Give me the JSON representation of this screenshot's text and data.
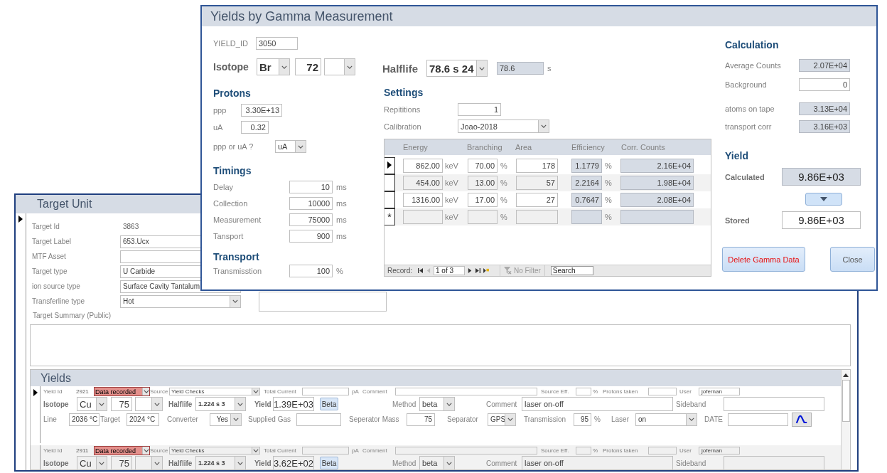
{
  "target_unit": {
    "title": "Target Unit",
    "fields": [
      {
        "label": "Target Id",
        "value": "3863",
        "kind": "text"
      },
      {
        "label": "Target Label",
        "value": "653.Ucx",
        "kind": "field"
      },
      {
        "label": "MTF Asset",
        "kind": "field"
      },
      {
        "label": "Target type",
        "value": "U Carbide",
        "kind": "field"
      },
      {
        "label": "ion source type",
        "value": "Surface Cavity Tantalum",
        "kind": "field"
      },
      {
        "label": "Transferline type",
        "value": "Hot",
        "kind": "dropdown"
      }
    ],
    "summary_label": "Target Summary (Public)",
    "yields": {
      "title": "Yields",
      "records": [
        {
          "selected": true,
          "yield_id_label": "Yield Id",
          "yield_id": "2921",
          "status": "Data recorded",
          "source_label": "Source",
          "source": "Yield Checks",
          "total_current_label": "Total Current",
          "current_unit": "pA",
          "comment_label": "Comment",
          "source_eff_label": "Source Eff.",
          "percent": "%",
          "protons_label": "Protons taken",
          "user_label": "User",
          "user": "jofernan",
          "isotope_label": "Isotope",
          "element": "Cu",
          "mass": "75",
          "halflife_label": "Halflife",
          "halflife": "1.224 s 3",
          "yield_label": "Yield",
          "yield": "1.39E+03",
          "beta_button": "Beta",
          "method_label": "Method",
          "method": "beta",
          "note_label": "Comment",
          "note": "laser on-off",
          "sideband_label": "Sideband",
          "line_label": "Line",
          "line": "2036 °C",
          "target_label": "Target",
          "target": "2024 °C",
          "converter_label": "Converter",
          "converter": "Yes",
          "gas_label": "Supplied Gas",
          "sep_mass_label": "Seperator Mass",
          "sep_mass": "75",
          "separator_label": "Separator",
          "separator": "GPS",
          "transmission_label": "Transmission",
          "transmission": "95",
          "transmission_unit": "%",
          "laser_label": "Laser",
          "laser": "on",
          "date_label": "DATE"
        },
        {
          "selected": false,
          "yield_id_label": "Yield Id",
          "yield_id": "2911",
          "status": "Data recorded",
          "source_label": "Source",
          "source": "Yield Checks",
          "total_current_label": "Total Current",
          "current_unit": "pA",
          "comment_label": "Comment",
          "source_eff_label": "Source Eff.",
          "percent": "%",
          "protons_label": "Protons taken",
          "user_label": "User",
          "user": "jofernan",
          "isotope_label": "Isotope",
          "element": "Cu",
          "mass": "75",
          "halflife_label": "Halflife",
          "halflife": "1.224 s 3",
          "yield_label": "Yield",
          "yield": "3.62E+02",
          "beta_button": "Beta",
          "method_label": "Method",
          "method": "beta",
          "note_label": "Comment",
          "note": "laser on-off",
          "sideband_label": "Sideband"
        }
      ]
    }
  },
  "gamma_dialog": {
    "title": "Yields by Gamma Measurement",
    "yield_id_label": "YIELD_ID",
    "yield_id": "3050",
    "isotope_label": "Isotope",
    "element": "Br",
    "mass": "72",
    "halflife_label": "Halflife",
    "halflife": "78.6 s 24",
    "halflife_value": "78.6",
    "halflife_unit": "s",
    "protons": {
      "heading": "Protons",
      "ppp_label": "ppp",
      "ppp": "3.30E+13",
      "ua_label": "uA",
      "ua": "0.32",
      "choice_label": "ppp or uA ?",
      "choice": "uA"
    },
    "timings": {
      "heading": "Timings",
      "rows": [
        {
          "label": "Delay",
          "value": "10",
          "unit": "ms"
        },
        {
          "label": "Collection",
          "value": "10000",
          "unit": "ms"
        },
        {
          "label": "Measurement",
          "value": "75000",
          "unit": "ms"
        },
        {
          "label": "Tansport",
          "value": "900",
          "unit": "ms"
        }
      ]
    },
    "transport": {
      "heading": "Transport",
      "label": "Transmisstion",
      "value": "100",
      "unit": "%"
    },
    "settings": {
      "heading": "Settings",
      "repetitions_label": "Repititions",
      "repetitions": "1",
      "calibration_label": "Calibration",
      "calibration": "Joao-2018"
    },
    "table": {
      "columns": [
        "Energy",
        "Branching",
        "Area",
        "Efficiency",
        "Corr. Counts"
      ],
      "rows": [
        {
          "selected": true,
          "energy": "862.00",
          "energy_unit": "keV",
          "branching": "70.00",
          "branching_unit": "%",
          "area": "178",
          "efficiency": "1.1779",
          "efficiency_unit": "%",
          "corr_counts": "2.16E+04"
        },
        {
          "selected": false,
          "energy": "454.00",
          "energy_unit": "keV",
          "branching": "13.00",
          "branching_unit": "%",
          "area": "57",
          "efficiency": "2.2164",
          "efficiency_unit": "%",
          "corr_counts": "1.98E+04"
        },
        {
          "selected": false,
          "energy": "1316.00",
          "energy_unit": "keV",
          "branching": "17.00",
          "branching_unit": "%",
          "area": "27",
          "efficiency": "0.7647",
          "efficiency_unit": "%",
          "corr_counts": "2.08E+04"
        },
        {
          "selected": false,
          "marker": "*",
          "energy_unit": "keV",
          "branching_unit": "%",
          "efficiency_unit": "%"
        }
      ],
      "nav": {
        "label": "Record:",
        "position": "1 of 3",
        "filter": "No Filter",
        "search": "Search"
      }
    },
    "calculation": {
      "heading": "Calculation",
      "rows": [
        {
          "label": "Average Counts",
          "value": "2.07E+04",
          "editable": false
        },
        {
          "label": "Background",
          "value": "0",
          "editable": true
        },
        {
          "label": "atoms on tape",
          "value": "3.13E+04",
          "editable": false
        },
        {
          "label": "transport corr",
          "value": "3.16E+03",
          "editable": false
        }
      ]
    },
    "yield": {
      "heading": "Yield",
      "calculated_label": "Calculated",
      "calculated": "9.86E+03",
      "stored_label": "Stored",
      "stored": "9.86E+03"
    },
    "buttons": [
      {
        "label": "Delete Gamma Data",
        "kind": "danger"
      },
      {
        "label": "Close",
        "kind": "normal"
      }
    ]
  }
}
